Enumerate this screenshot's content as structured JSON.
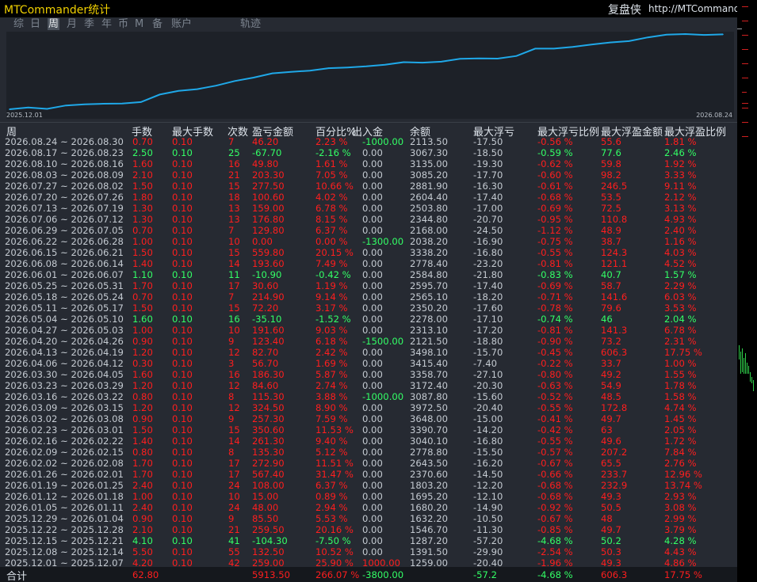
{
  "window": {
    "app_title": "MTCommander统计",
    "brand_name": "复盘侠",
    "brand_url": "http://MTCommander.com"
  },
  "tabs": [
    {
      "label": "综",
      "active": false
    },
    {
      "label": "日",
      "active": false
    },
    {
      "label": "周",
      "active": true
    },
    {
      "label": "月",
      "active": false
    },
    {
      "label": "季",
      "active": false
    },
    {
      "label": "年",
      "active": false
    },
    {
      "label": "币",
      "active": false
    },
    {
      "label": "M",
      "active": false
    },
    {
      "label": "备",
      "active": false
    },
    {
      "label": "账户",
      "active": false
    },
    {
      "label": "轨迹",
      "active": false
    }
  ],
  "chart_data": {
    "type": "line",
    "x": [
      "2025.12.01",
      "2025.12.08",
      "2025.12.15",
      "2025.12.22",
      "2025.12.29",
      "2026.01.05",
      "2026.01.12",
      "2026.01.19",
      "2026.01.26",
      "2026.02.02",
      "2026.02.09",
      "2026.02.16",
      "2026.02.23",
      "2026.03.02",
      "2026.03.09",
      "2026.03.16",
      "2026.03.23",
      "2026.03.30",
      "2026.04.06",
      "2026.04.13",
      "2026.04.20",
      "2026.04.27",
      "2026.05.04",
      "2026.05.11",
      "2026.05.18",
      "2026.05.25",
      "2026.06.01",
      "2026.06.08",
      "2026.06.15",
      "2026.06.22",
      "2026.06.29",
      "2026.07.06",
      "2026.07.13",
      "2026.07.20",
      "2026.07.27",
      "2026.08.03",
      "2026.08.10",
      "2026.08.17",
      "2026.08.24"
    ],
    "values": [
      259.0,
      391.5,
      287.2,
      546.7,
      632.2,
      680.2,
      695.2,
      803.2,
      1370.6,
      1643.5,
      1778.8,
      2040.0,
      2390.6,
      2648.0,
      2972.8,
      3087.8,
      3172.4,
      3358.7,
      3415.4,
      3498.1,
      3621.5,
      3813.1,
      3778.0,
      3850.2,
      4065.1,
      4095.7,
      4084.8,
      4278.4,
      4838.2,
      4838.2,
      4968.0,
      5144.8,
      5303.8,
      5404.4,
      5681.9,
      5885.2,
      5935.0,
      5867.3,
      5913.5
    ],
    "x_tick_labels": [
      "2025.12.01",
      "2026.08.24"
    ],
    "grid": false,
    "line_color": "#1fa8e8"
  },
  "table": {
    "headers": [
      "周",
      "手数",
      "最大手数",
      "次数",
      "盈亏金额",
      "百分比%",
      "出入金",
      "余额",
      "最大浮亏",
      "最大浮亏比例",
      "最大浮盈金额",
      "最大浮盈比例"
    ],
    "rows": [
      [
        "2026.08.24 ~ 2026.08.30",
        "0.70",
        "0.10",
        "7",
        "46.20",
        "2.23 %",
        "-1000.00",
        "2113.50",
        "-17.50",
        "-0.56 %",
        "55.6",
        "1.81 %"
      ],
      [
        "2026.08.17 ~ 2026.08.23",
        "2.50",
        "0.10",
        "25",
        "-67.70",
        "-2.16 %",
        "0.00",
        "3067.30",
        "-18.50",
        "-0.59 %",
        "77.6",
        "2.46 %"
      ],
      [
        "2026.08.10 ~ 2026.08.16",
        "1.60",
        "0.10",
        "16",
        "49.80",
        "1.61 %",
        "0.00",
        "3135.00",
        "-19.30",
        "-0.62 %",
        "59.8",
        "1.92 %"
      ],
      [
        "2026.08.03 ~ 2026.08.09",
        "2.10",
        "0.10",
        "21",
        "203.30",
        "7.05 %",
        "0.00",
        "3085.20",
        "-17.70",
        "-0.60 %",
        "98.2",
        "3.33 %"
      ],
      [
        "2026.07.27 ~ 2026.08.02",
        "1.50",
        "0.10",
        "15",
        "277.50",
        "10.66 %",
        "0.00",
        "2881.90",
        "-16.30",
        "-0.61 %",
        "246.5",
        "9.11 %"
      ],
      [
        "2026.07.20 ~ 2026.07.26",
        "1.80",
        "0.10",
        "18",
        "100.60",
        "4.02 %",
        "0.00",
        "2604.40",
        "-17.40",
        "-0.68 %",
        "53.5",
        "2.12 %"
      ],
      [
        "2026.07.13 ~ 2026.07.19",
        "1.30",
        "0.10",
        "13",
        "159.00",
        "6.78 %",
        "0.00",
        "2503.80",
        "-17.00",
        "-0.69 %",
        "72.5",
        "3.13 %"
      ],
      [
        "2026.07.06 ~ 2026.07.12",
        "1.30",
        "0.10",
        "13",
        "176.80",
        "8.15 %",
        "0.00",
        "2344.80",
        "-20.70",
        "-0.95 %",
        "110.8",
        "4.93 %"
      ],
      [
        "2026.06.29 ~ 2026.07.05",
        "0.70",
        "0.10",
        "7",
        "129.80",
        "6.37 %",
        "0.00",
        "2168.00",
        "-24.50",
        "-1.12 %",
        "48.9",
        "2.40 %"
      ],
      [
        "2026.06.22 ~ 2026.06.28",
        "1.00",
        "0.10",
        "10",
        "0.00",
        "0.00 %",
        "-1300.00",
        "2038.20",
        "-16.90",
        "-0.75 %",
        "38.7",
        "1.16 %"
      ],
      [
        "2026.06.15 ~ 2026.06.21",
        "1.50",
        "0.10",
        "15",
        "559.80",
        "20.15 %",
        "0.00",
        "3338.20",
        "-16.80",
        "-0.55 %",
        "124.3",
        "4.03 %"
      ],
      [
        "2026.06.08 ~ 2026.06.14",
        "1.40",
        "0.10",
        "14",
        "193.60",
        "7.49 %",
        "0.00",
        "2778.40",
        "-23.20",
        "-0.81 %",
        "121.1",
        "4.52 %"
      ],
      [
        "2026.06.01 ~ 2026.06.07",
        "1.10",
        "0.10",
        "11",
        "-10.90",
        "-0.42 %",
        "0.00",
        "2584.80",
        "-21.80",
        "-0.83 %",
        "40.7",
        "1.57 %"
      ],
      [
        "2026.05.25 ~ 2026.05.31",
        "1.70",
        "0.10",
        "17",
        "30.60",
        "1.19 %",
        "0.00",
        "2595.70",
        "-17.40",
        "-0.69 %",
        "58.7",
        "2.29 %"
      ],
      [
        "2026.05.18 ~ 2026.05.24",
        "0.70",
        "0.10",
        "7",
        "214.90",
        "9.14 %",
        "0.00",
        "2565.10",
        "-18.20",
        "-0.71 %",
        "141.6",
        "6.03 %"
      ],
      [
        "2026.05.11 ~ 2026.05.17",
        "1.50",
        "0.10",
        "15",
        "72.20",
        "3.17 %",
        "0.00",
        "2350.20",
        "-17.60",
        "-0.78 %",
        "79.6",
        "3.53 %"
      ],
      [
        "2026.05.04 ~ 2026.05.10",
        "1.60",
        "0.10",
        "16",
        "-35.10",
        "-1.52 %",
        "0.00",
        "2278.00",
        "-17.10",
        "-0.74 %",
        "46",
        "2.04 %"
      ],
      [
        "2026.04.27 ~ 2026.05.03",
        "1.00",
        "0.10",
        "10",
        "191.60",
        "9.03 %",
        "0.00",
        "2313.10",
        "-17.20",
        "-0.81 %",
        "141.3",
        "6.78 %"
      ],
      [
        "2026.04.20 ~ 2026.04.26",
        "0.90",
        "0.10",
        "9",
        "123.40",
        "6.18 %",
        "-1500.00",
        "2121.50",
        "-18.80",
        "-0.90 %",
        "73.2",
        "2.31 %"
      ],
      [
        "2026.04.13 ~ 2026.04.19",
        "1.20",
        "0.10",
        "12",
        "82.70",
        "2.42 %",
        "0.00",
        "3498.10",
        "-15.70",
        "-0.45 %",
        "606.3",
        "17.75 %"
      ],
      [
        "2026.04.06 ~ 2026.04.12",
        "0.30",
        "0.10",
        "3",
        "56.70",
        "1.69 %",
        "0.00",
        "3415.40",
        "-7.40",
        "-0.22 %",
        "33.7",
        "1.00 %"
      ],
      [
        "2026.03.30 ~ 2026.04.05",
        "1.60",
        "0.10",
        "16",
        "186.30",
        "5.87 %",
        "0.00",
        "3358.70",
        "-27.10",
        "-0.80 %",
        "49.2",
        "1.55 %"
      ],
      [
        "2026.03.23 ~ 2026.03.29",
        "1.20",
        "0.10",
        "12",
        "84.60",
        "2.74 %",
        "0.00",
        "3172.40",
        "-20.30",
        "-0.63 %",
        "54.9",
        "1.78 %"
      ],
      [
        "2026.03.16 ~ 2026.03.22",
        "0.80",
        "0.10",
        "8",
        "115.30",
        "3.88 %",
        "-1000.00",
        "3087.80",
        "-15.60",
        "-0.52 %",
        "48.5",
        "1.58 %"
      ],
      [
        "2026.03.09 ~ 2026.03.15",
        "1.20",
        "0.10",
        "12",
        "324.50",
        "8.90 %",
        "0.00",
        "3972.50",
        "-20.40",
        "-0.55 %",
        "172.8",
        "4.74 %"
      ],
      [
        "2026.03.02 ~ 2026.03.08",
        "0.90",
        "0.10",
        "9",
        "257.30",
        "7.59 %",
        "0.00",
        "3648.00",
        "-15.00",
        "-0.41 %",
        "49.7",
        "1.45 %"
      ],
      [
        "2026.02.23 ~ 2026.03.01",
        "1.50",
        "0.10",
        "15",
        "350.60",
        "11.53 %",
        "0.00",
        "3390.70",
        "-14.20",
        "-0.42 %",
        "63",
        "2.05 %"
      ],
      [
        "2026.02.16 ~ 2026.02.22",
        "1.40",
        "0.10",
        "14",
        "261.30",
        "9.40 %",
        "0.00",
        "3040.10",
        "-16.80",
        "-0.55 %",
        "49.6",
        "1.72 %"
      ],
      [
        "2026.02.09 ~ 2026.02.15",
        "0.80",
        "0.10",
        "8",
        "135.30",
        "5.12 %",
        "0.00",
        "2778.80",
        "-15.50",
        "-0.57 %",
        "207.2",
        "7.84 %"
      ],
      [
        "2026.02.02 ~ 2026.02.08",
        "1.70",
        "0.10",
        "17",
        "272.90",
        "11.51 %",
        "0.00",
        "2643.50",
        "-16.20",
        "-0.67 %",
        "65.5",
        "2.76 %"
      ],
      [
        "2026.01.26 ~ 2026.02.01",
        "1.70",
        "0.10",
        "17",
        "567.40",
        "31.47 %",
        "0.00",
        "2370.60",
        "-14.50",
        "-0.66 %",
        "233.7",
        "12.96 %"
      ],
      [
        "2026.01.19 ~ 2026.01.25",
        "2.40",
        "0.10",
        "24",
        "108.00",
        "6.37 %",
        "0.00",
        "1803.20",
        "-12.20",
        "-0.68 %",
        "232.9",
        "13.74 %"
      ],
      [
        "2026.01.12 ~ 2026.01.18",
        "1.00",
        "0.10",
        "10",
        "15.00",
        "0.89 %",
        "0.00",
        "1695.20",
        "-12.10",
        "-0.68 %",
        "49.3",
        "2.93 %"
      ],
      [
        "2026.01.05 ~ 2026.01.11",
        "2.40",
        "0.10",
        "24",
        "48.00",
        "2.94 %",
        "0.00",
        "1680.20",
        "-14.90",
        "-0.92 %",
        "50.5",
        "3.08 %"
      ],
      [
        "2025.12.29 ~ 2026.01.04",
        "0.90",
        "0.10",
        "9",
        "85.50",
        "5.53 %",
        "0.00",
        "1632.20",
        "-10.50",
        "-0.67 %",
        "48",
        "2.99 %"
      ],
      [
        "2025.12.22 ~ 2025.12.28",
        "2.10",
        "0.10",
        "21",
        "259.50",
        "20.16 %",
        "0.00",
        "1546.70",
        "-11.30",
        "-0.85 %",
        "49.7",
        "3.79 %"
      ],
      [
        "2025.12.15 ~ 2025.12.21",
        "4.10",
        "0.10",
        "41",
        "-104.30",
        "-7.50 %",
        "0.00",
        "1287.20",
        "-57.20",
        "-4.68 %",
        "50.2",
        "4.28 %"
      ],
      [
        "2025.12.08 ~ 2025.12.14",
        "5.50",
        "0.10",
        "55",
        "132.50",
        "10.52 %",
        "0.00",
        "1391.50",
        "-29.90",
        "-2.54 %",
        "50.3",
        "4.43 %"
      ],
      [
        "2025.12.01 ~ 2025.12.07",
        "4.20",
        "0.10",
        "42",
        "259.00",
        "25.90 %",
        "1000.00",
        "1259.00",
        "-20.40",
        "-1.96 %",
        "49.3",
        "4.86 %"
      ]
    ],
    "total": {
      "label": "合计",
      "values": [
        "",
        "62.80",
        "",
        "",
        "5913.50",
        "266.07 %",
        "-3800.00",
        "",
        "-57.2",
        "-4.68 %",
        "606.3",
        "17.75 %"
      ]
    }
  },
  "colors": {
    "positive": "#ff1e1e",
    "negative": "#33ff66",
    "neutral": "#c4cad1",
    "title": "#f0d000",
    "line": "#1fa8e8"
  }
}
